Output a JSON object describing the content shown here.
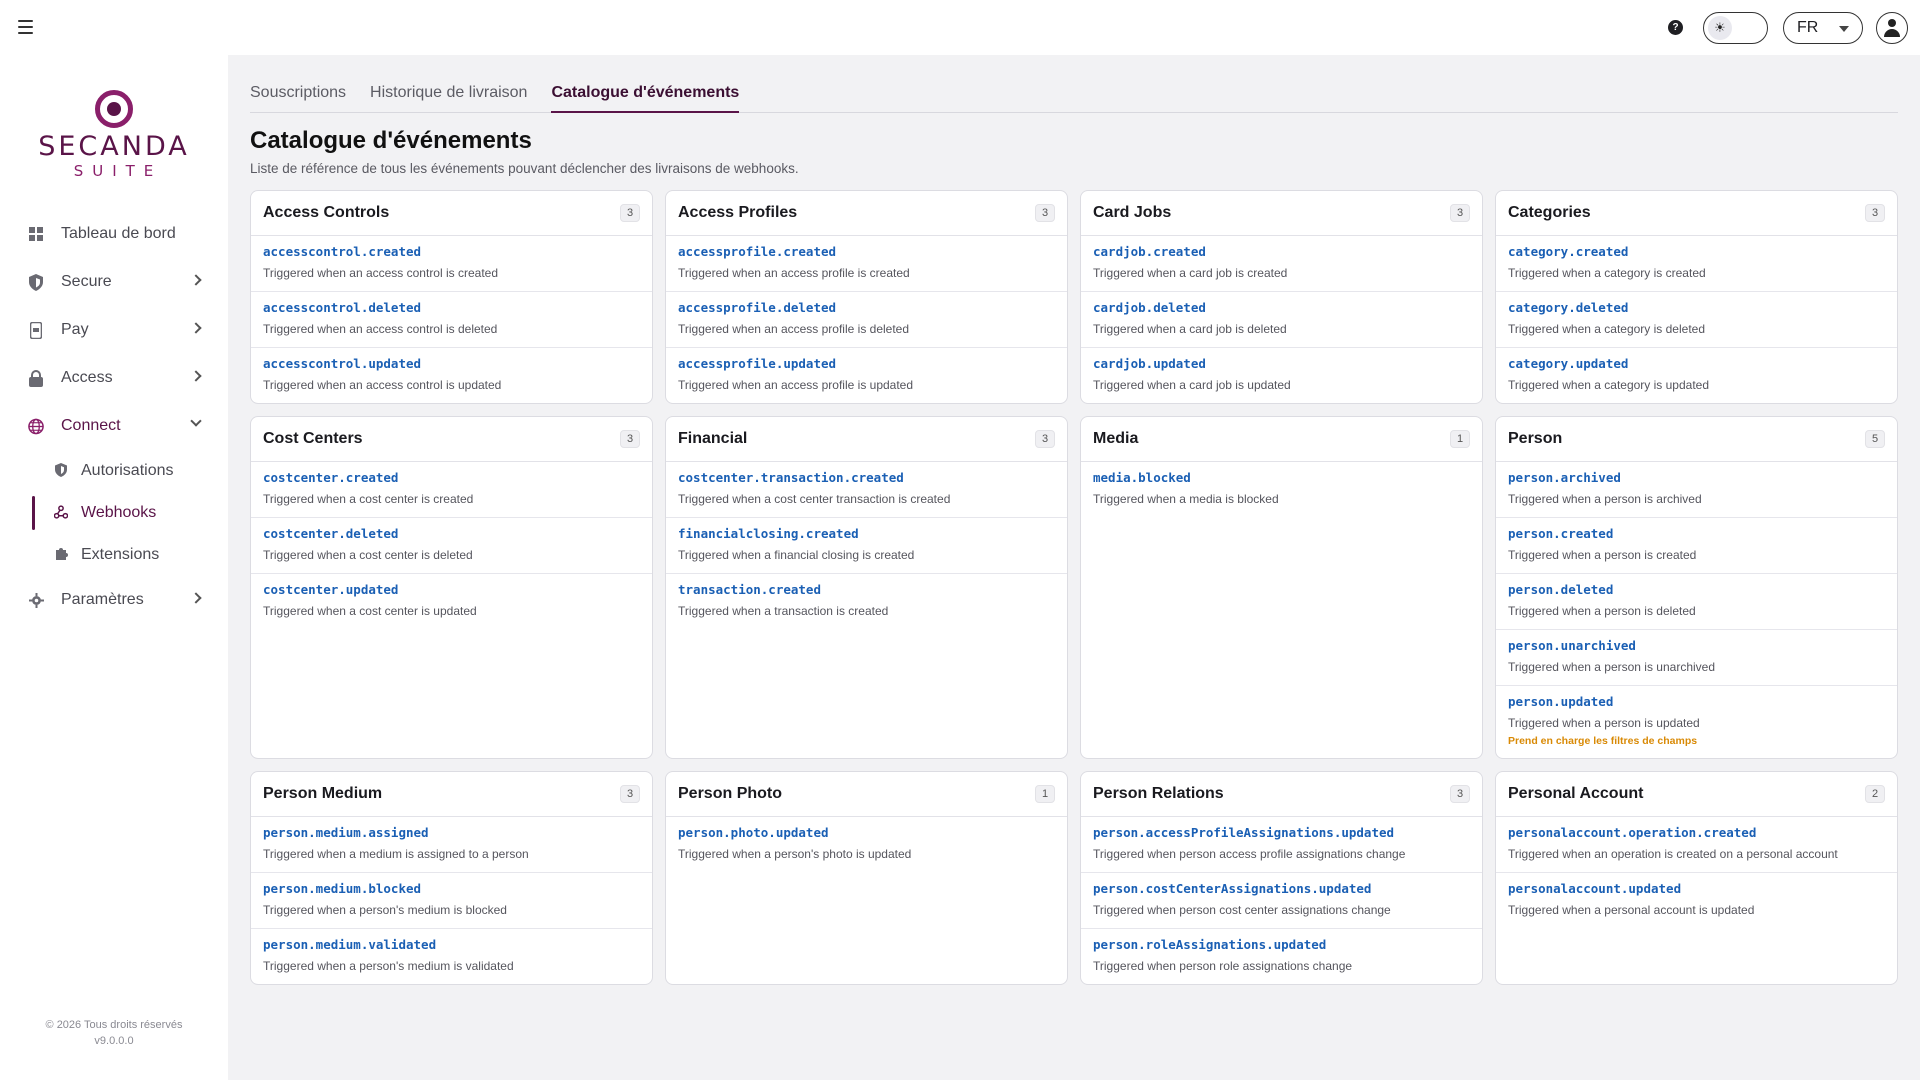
{
  "header": {
    "help_glyph": "?",
    "theme_glyph": "☀",
    "language": "FR"
  },
  "sidebar": {
    "logo_text": "SECANDA",
    "logo_sub": "SUITE",
    "items": [
      {
        "label": "Tableau de bord",
        "icon": "grid-icon"
      },
      {
        "label": "Secure",
        "icon": "shield-icon"
      },
      {
        "label": "Pay",
        "icon": "phone-card-icon"
      },
      {
        "label": "Access",
        "icon": "lock-icon"
      },
      {
        "label": "Connect",
        "icon": "globe-icon"
      }
    ],
    "subitems": [
      {
        "label": "Autorisations",
        "icon": "shield-small-icon"
      },
      {
        "label": "Webhooks",
        "icon": "webhook-icon"
      },
      {
        "label": "Extensions",
        "icon": "puzzle-icon"
      }
    ],
    "settings": {
      "label": "Paramètres",
      "icon": "gear-icon"
    },
    "footer_copyright": "© 2026 Tous droits réservés",
    "footer_version": "v9.0.0.0"
  },
  "tabs": [
    "Souscriptions",
    "Historique de livraison",
    "Catalogue d'événements"
  ],
  "active_tab": "Catalogue d'événements",
  "page": {
    "title": "Catalogue d'événements",
    "subtitle": "Liste de référence de tous les événements pouvant déclencher des livraisons de webhooks."
  },
  "cards": [
    {
      "title": "Access Controls",
      "count": "3",
      "events": [
        {
          "name": "accesscontrol.created",
          "desc": "Triggered when an access control is created"
        },
        {
          "name": "accesscontrol.deleted",
          "desc": "Triggered when an access control is deleted"
        },
        {
          "name": "accesscontrol.updated",
          "desc": "Triggered when an access control is updated"
        }
      ]
    },
    {
      "title": "Access Profiles",
      "count": "3",
      "events": [
        {
          "name": "accessprofile.created",
          "desc": "Triggered when an access profile is created"
        },
        {
          "name": "accessprofile.deleted",
          "desc": "Triggered when an access profile is deleted"
        },
        {
          "name": "accessprofile.updated",
          "desc": "Triggered when an access profile is updated"
        }
      ]
    },
    {
      "title": "Card Jobs",
      "count": "3",
      "events": [
        {
          "name": "cardjob.created",
          "desc": "Triggered when a card job is created"
        },
        {
          "name": "cardjob.deleted",
          "desc": "Triggered when a card job is deleted"
        },
        {
          "name": "cardjob.updated",
          "desc": "Triggered when a card job is updated"
        }
      ]
    },
    {
      "title": "Categories",
      "count": "3",
      "events": [
        {
          "name": "category.created",
          "desc": "Triggered when a category is created"
        },
        {
          "name": "category.deleted",
          "desc": "Triggered when a category is deleted"
        },
        {
          "name": "category.updated",
          "desc": "Triggered when a category is updated"
        }
      ]
    },
    {
      "title": "Cost Centers",
      "count": "3",
      "events": [
        {
          "name": "costcenter.created",
          "desc": "Triggered when a cost center is created"
        },
        {
          "name": "costcenter.deleted",
          "desc": "Triggered when a cost center is deleted"
        },
        {
          "name": "costcenter.updated",
          "desc": "Triggered when a cost center is updated"
        }
      ]
    },
    {
      "title": "Financial",
      "count": "3",
      "events": [
        {
          "name": "costcenter.transaction.created",
          "desc": "Triggered when a cost center transaction is created"
        },
        {
          "name": "financialclosing.created",
          "desc": "Triggered when a financial closing is created"
        },
        {
          "name": "transaction.created",
          "desc": "Triggered when a transaction is created"
        }
      ]
    },
    {
      "title": "Media",
      "count": "1",
      "events": [
        {
          "name": "media.blocked",
          "desc": "Triggered when a media is blocked"
        }
      ]
    },
    {
      "title": "Person",
      "count": "5",
      "events": [
        {
          "name": "person.archived",
          "desc": "Triggered when a person is archived"
        },
        {
          "name": "person.created",
          "desc": "Triggered when a person is created"
        },
        {
          "name": "person.deleted",
          "desc": "Triggered when a person is deleted"
        },
        {
          "name": "person.unarchived",
          "desc": "Triggered when a person is unarchived"
        },
        {
          "name": "person.updated",
          "desc": "Triggered when a person is updated",
          "note": "Prend en charge les filtres de champs"
        }
      ]
    },
    {
      "title": "Person Medium",
      "count": "3",
      "events": [
        {
          "name": "person.medium.assigned",
          "desc": "Triggered when a medium is assigned to a person"
        },
        {
          "name": "person.medium.blocked",
          "desc": "Triggered when a person's medium is blocked"
        },
        {
          "name": "person.medium.validated",
          "desc": "Triggered when a person's medium is validated"
        }
      ]
    },
    {
      "title": "Person Photo",
      "count": "1",
      "events": [
        {
          "name": "person.photo.updated",
          "desc": "Triggered when a person's photo is updated"
        }
      ]
    },
    {
      "title": "Person Relations",
      "count": "3",
      "events": [
        {
          "name": "person.accessProfileAssignations.updated",
          "desc": "Triggered when person access profile assignations change"
        },
        {
          "name": "person.costCenterAssignations.updated",
          "desc": "Triggered when person cost center assignations change"
        },
        {
          "name": "person.roleAssignations.updated",
          "desc": "Triggered when person role assignations change"
        }
      ]
    },
    {
      "title": "Personal Account",
      "count": "2",
      "events": [
        {
          "name": "personalaccount.operation.created",
          "desc": "Triggered when an operation is created on a personal account"
        },
        {
          "name": "personalaccount.updated",
          "desc": "Triggered when a personal account is updated"
        }
      ]
    }
  ]
}
